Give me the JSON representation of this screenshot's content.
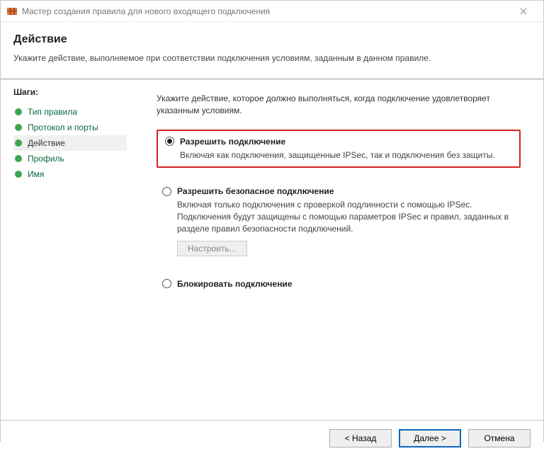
{
  "window": {
    "title": "Мастер создания правила для нового входящего подключения"
  },
  "header": {
    "title": "Действие",
    "subtitle": "Укажите действие, выполняемое при соответствии подключения условиям, заданным в данном правиле."
  },
  "sidebar": {
    "title": "Шаги:",
    "items": [
      {
        "label": "Тип правила",
        "active": false
      },
      {
        "label": "Протокол и порты",
        "active": false
      },
      {
        "label": "Действие",
        "active": true
      },
      {
        "label": "Профиль",
        "active": false
      },
      {
        "label": "Имя",
        "active": false
      }
    ]
  },
  "main": {
    "intro": "Укажите действие, которое должно выполняться, когда подключение удовлетворяет указанным условиям.",
    "options": [
      {
        "title": "Разрешить подключение",
        "desc": "Включая как подключения, защищенные IPSec, так и подключения без защиты.",
        "checked": true,
        "highlight": true
      },
      {
        "title": "Разрешить безопасное подключение",
        "desc": "Включая только подключения с проверкой подлинности с помощью IPSec. Подключения будут защищены с помощью параметров IPSec и правил, заданных в разделе правил безопасности подключений.",
        "checked": false,
        "highlight": false,
        "configure_label": "Настроить..."
      },
      {
        "title": "Блокировать подключение",
        "desc": "",
        "checked": false,
        "highlight": false
      }
    ]
  },
  "footer": {
    "back": "< Назад",
    "next": "Далее >",
    "cancel": "Отмена"
  }
}
